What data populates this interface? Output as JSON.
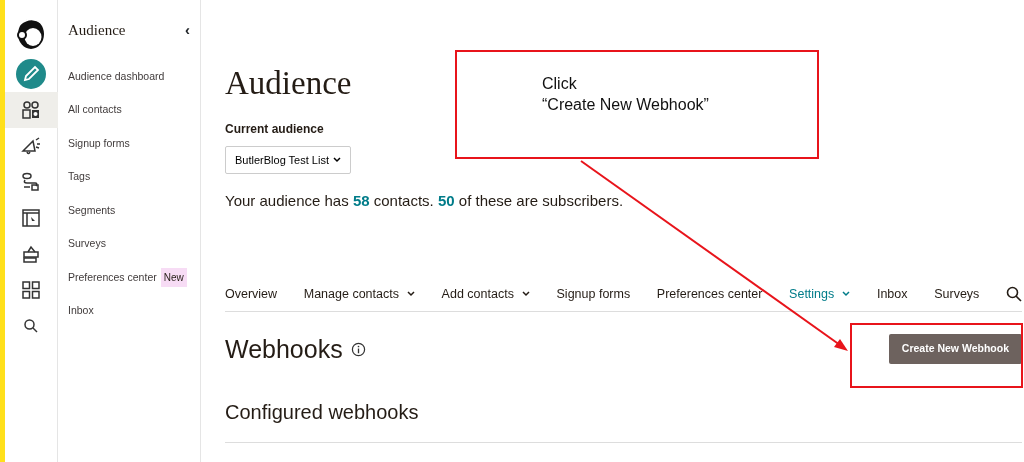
{
  "rail": [
    {
      "kind": "logo",
      "selected": false
    },
    {
      "kind": "create",
      "selected": false
    },
    {
      "kind": "audience",
      "selected": true
    },
    {
      "kind": "campaigns",
      "selected": false
    },
    {
      "kind": "automations",
      "selected": false
    },
    {
      "kind": "website",
      "selected": false
    },
    {
      "kind": "integrations",
      "selected": false
    },
    {
      "kind": "grid",
      "selected": false
    },
    {
      "kind": "search",
      "selected": false
    }
  ],
  "sidebar": {
    "title": "Audience",
    "collapse_icon": "‹",
    "items": [
      {
        "label": "Audience dashboard"
      },
      {
        "label": "All contacts"
      },
      {
        "label": "Signup forms"
      },
      {
        "label": "Tags"
      },
      {
        "label": "Segments"
      },
      {
        "label": "Surveys"
      },
      {
        "label": "Preferences center",
        "badge": "New"
      },
      {
        "label": "Inbox"
      }
    ]
  },
  "main": {
    "title": "Audience",
    "current_label": "Current audience",
    "audience_select": "ButlerBlog Test List",
    "summary": "Your audience has **58** contacts. **50** of these are subscribers.",
    "tabs": [
      {
        "label": "Overview",
        "selected": false,
        "menu": false
      },
      {
        "label": "Manage contacts",
        "selected": false,
        "menu": true
      },
      {
        "label": "Add contacts",
        "selected": false,
        "menu": true
      },
      {
        "label": "Signup forms",
        "selected": false,
        "menu": false
      },
      {
        "label": "Preferences center",
        "selected": false,
        "menu": false
      },
      {
        "label": "Settings",
        "selected": true,
        "menu": true
      },
      {
        "label": "Inbox",
        "selected": false,
        "menu": false
      },
      {
        "label": "Surveys",
        "selected": false,
        "menu": false
      }
    ],
    "section_title": "Webhooks",
    "create_button": "Create New Webhook",
    "subsection_title": "Configured webhooks"
  },
  "annotation": {
    "lines": [
      "Click",
      "“Create New Webhook”"
    ]
  }
}
